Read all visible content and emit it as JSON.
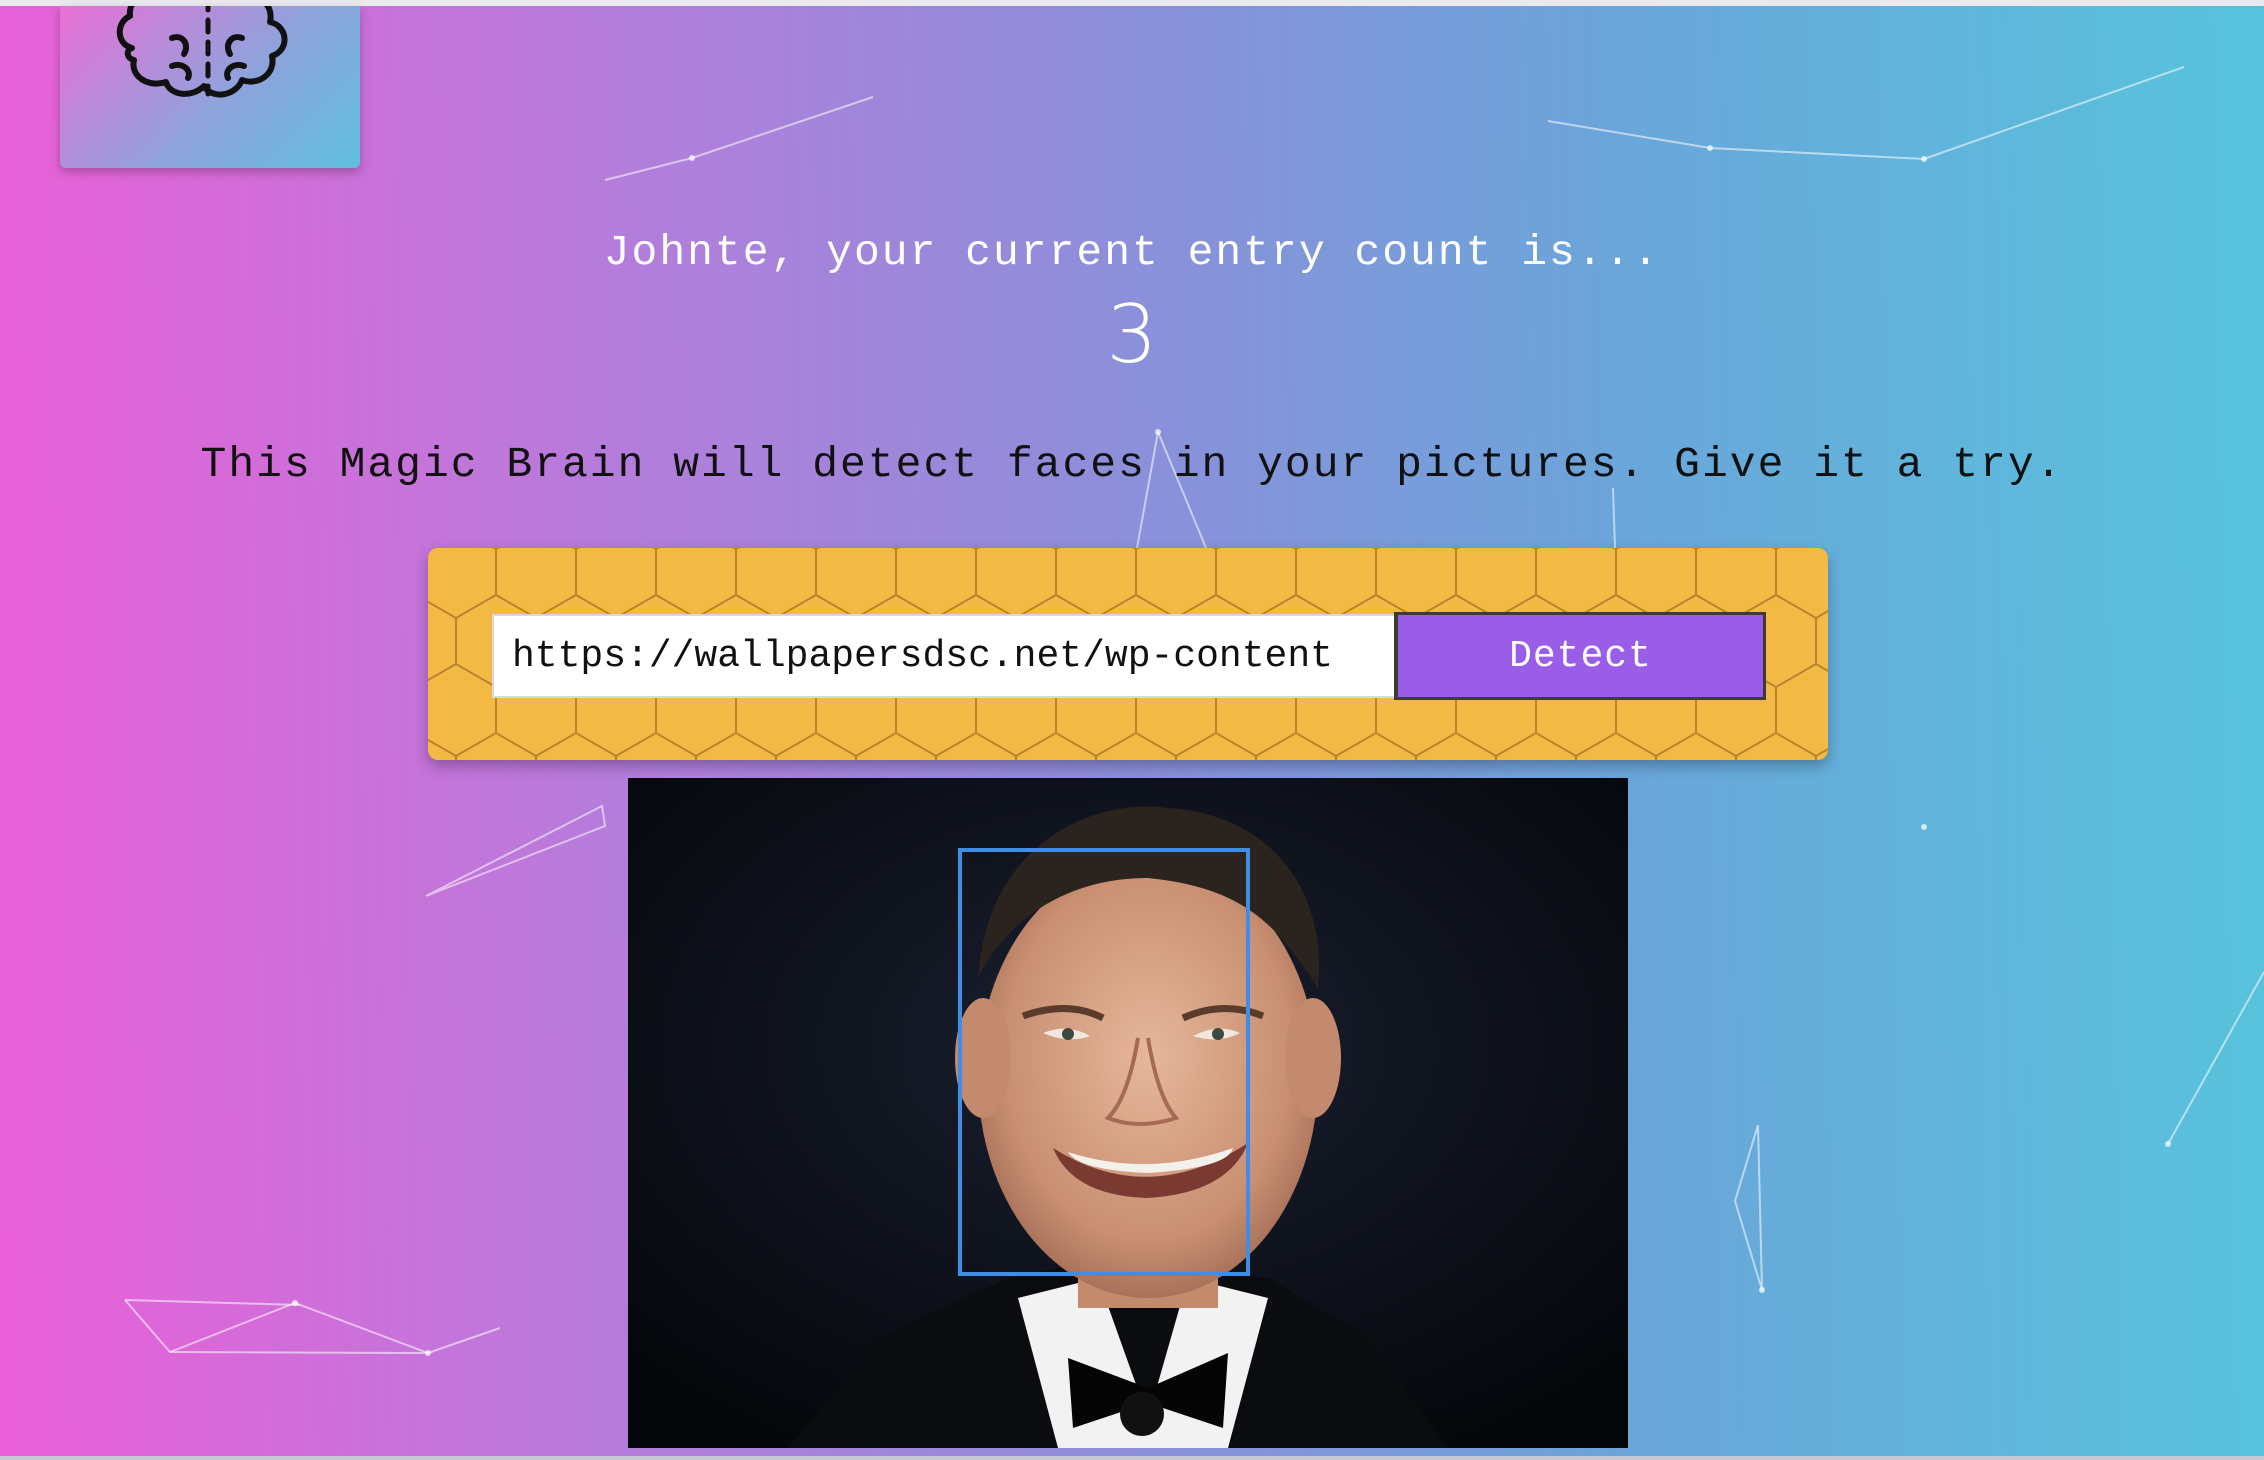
{
  "header": {
    "logo_icon": "brain-icon"
  },
  "rank": {
    "greeting": "Johnte, your current entry count is...",
    "count": "3"
  },
  "main": {
    "tagline": "This Magic Brain will detect faces in your pictures. Give it a try."
  },
  "form": {
    "url_value": "https://wallpapersdsc.net/wp-content",
    "detect_label": "Detect"
  },
  "result": {
    "faces_detected": 1,
    "box_color": "#3f8ee5"
  },
  "colors": {
    "gradient_start": "#ea5fd8",
    "gradient_end": "#57c3dc",
    "panel": "#f2b944",
    "button": "#9a5de8"
  }
}
